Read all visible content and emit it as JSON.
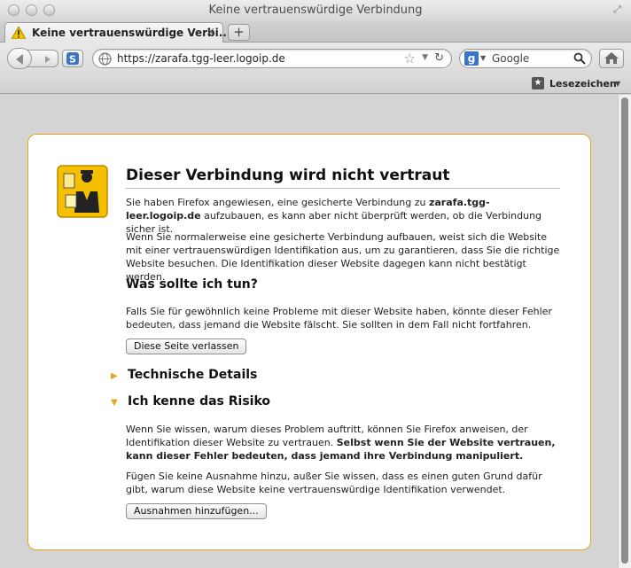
{
  "window": {
    "title": "Keine vertrauenswürdige Verbindung"
  },
  "tabs": [
    {
      "label": "Keine vertrauenswürdige Verbi..."
    }
  ],
  "toolbar": {
    "url": "https://zarafa.tgg-leer.logoip.de",
    "search_placeholder": "Google",
    "search_engine": "g"
  },
  "bookmarks": {
    "label": "Lesezeichen"
  },
  "page": {
    "title": "Dieser Verbindung wird nicht vertraut",
    "intro_before": "Sie haben Firefox angewiesen, eine gesicherte Verbindung zu ",
    "intro_host": "zarafa.tgg-leer.logoip.de",
    "intro_after": " aufzubauen, es kann aber nicht überprüft werden, ob die Verbindung sicher ist.",
    "explanation": "Wenn Sie normalerweise eine gesicherte Verbindung aufbauen, weist sich die Website mit einer vertrauenswürdigen Identifikation aus, um zu garantieren, dass Sie die richtige Website besuchen. Die Identifikation dieser Website dagegen kann nicht bestätigt werden.",
    "what_heading": "Was sollte ich tun?",
    "what_text": "Falls Sie für gewöhnlich keine Probleme mit dieser Website haben, könnte dieser Fehler bedeuten, dass jemand die Website fälscht. Sie sollten in dem Fall nicht fortfahren.",
    "leave_button": "Diese Seite verlassen",
    "technical_heading": "Technische Details",
    "risk_heading": "Ich kenne das Risiko",
    "risk_text_before": "Wenn Sie wissen, warum dieses Problem auftritt, können Sie Firefox anweisen, der Identifikation dieser Website zu vertrauen. ",
    "risk_text_bold": "Selbst wenn Sie der Website vertrauen, kann dieser Fehler bedeuten, dass jemand ihre Verbindung manipuliert.",
    "exception_note": "Fügen Sie keine Ausnahme hinzu, außer Sie wissen, dass es einen guten Grund dafür gibt, warum diese Website keine vertrauenswürdige Identifikation verwendet.",
    "add_exception_button": "Ausnahmen hinzufügen..."
  },
  "colors": {
    "accent_border": "#e8a421",
    "icon_yellow": "#f6c000"
  }
}
